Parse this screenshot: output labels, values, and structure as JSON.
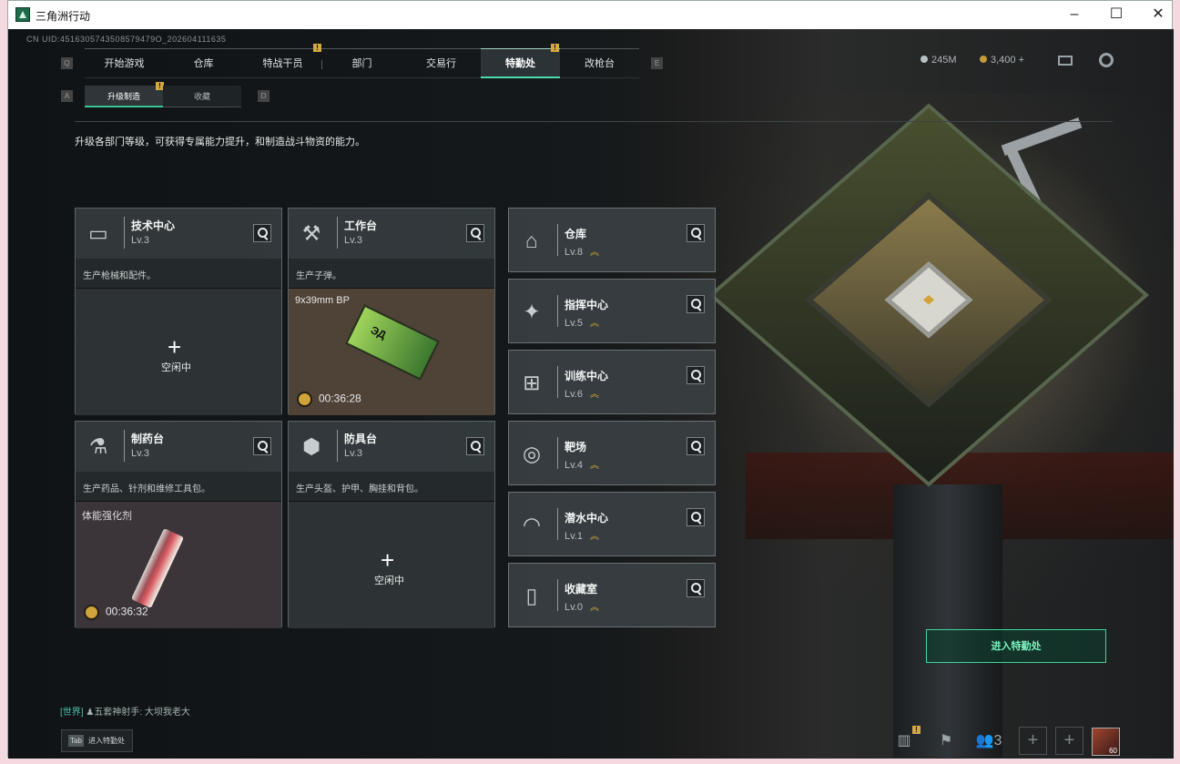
{
  "window": {
    "title": "三角洲行动",
    "minimize": "–",
    "maximize": "☐",
    "close": "✕"
  },
  "uid": "CN UID:4516305743508579479O_202604111635",
  "nav": {
    "keys": [
      "Q",
      "E"
    ],
    "tabs": [
      "开始游戏",
      "仓库",
      "特战干员",
      "部门",
      "交易行",
      "特勤处",
      "改枪台"
    ],
    "active": "特勤处",
    "badge_tabs": [
      "特战干员",
      "特勤处"
    ]
  },
  "currency": {
    "left": "245M",
    "right": "3,400 +"
  },
  "subnav": {
    "keys": [
      "A",
      "D"
    ],
    "tabs": [
      "升级制造",
      "收藏"
    ],
    "active": "升级制造"
  },
  "description": "升级各部门等级，可获得专属能力提升，和制造战斗物资的能力。",
  "cards_left": [
    {
      "title": "技术中心",
      "level": "Lv.3",
      "desc": "生产枪械和配件。",
      "status": "空闲中",
      "icon": "monitor-icon"
    },
    {
      "title": "工作台",
      "level": "Lv.3",
      "desc": "生产子弹。",
      "item": "9x39mm BP",
      "timer": "00:36:28",
      "icon": "tools-icon"
    },
    {
      "title": "制药台",
      "level": "Lv.3",
      "desc": "生产药品、针剂和维修工具包。",
      "item": "体能强化剂",
      "timer": "00:36:32",
      "icon": "microscope-icon"
    },
    {
      "title": "防具台",
      "level": "Lv.3",
      "desc": "生产头盔、护甲、胸挂和背包。",
      "status": "空闲中",
      "icon": "cubes-icon"
    }
  ],
  "cards_right": [
    {
      "title": "仓库",
      "level": "Lv.8",
      "icon": "warehouse-icon"
    },
    {
      "title": "指挥中心",
      "level": "Lv.5",
      "icon": "command-icon"
    },
    {
      "title": "训练中心",
      "level": "Lv.6",
      "icon": "dumbbell-icon"
    },
    {
      "title": "靶场",
      "level": "Lv.4",
      "icon": "target-icon"
    },
    {
      "title": "潜水中心",
      "level": "Lv.1",
      "icon": "goggles-icon"
    },
    {
      "title": "收藏室",
      "level": "Lv.0",
      "icon": "cabinet-icon"
    }
  ],
  "enter_button": "进入特勤处",
  "chat": {
    "channel": "[世界]",
    "sender": "五套神射手",
    "message": ": 大坝我老大"
  },
  "tab_hint": {
    "key": "Tab",
    "label": "进入特勤处"
  },
  "bottom": {
    "friends_count": "3",
    "avatar_level": "60"
  },
  "colors": {
    "accent": "#4bdcaa",
    "badge": "#d3a93d",
    "panel": "#343a3c",
    "ammo_bg": "#4f4236",
    "stim_bg": "#3b3438"
  }
}
